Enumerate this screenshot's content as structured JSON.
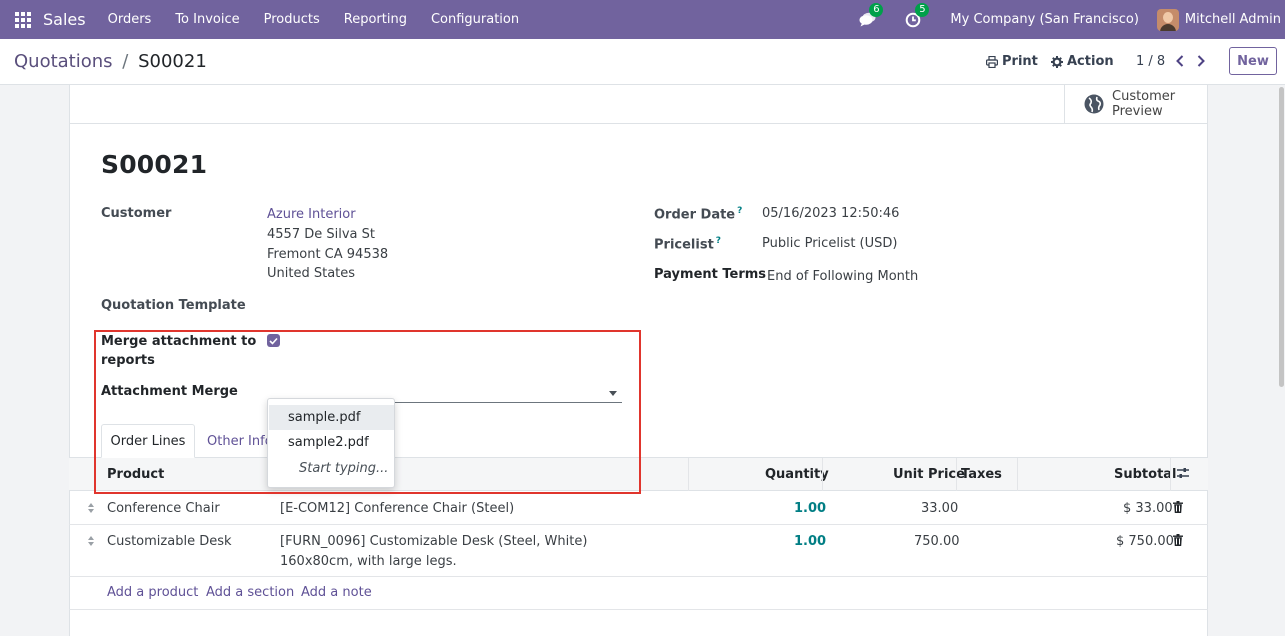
{
  "nav": {
    "brand": "Sales",
    "menu": [
      "Orders",
      "To Invoice",
      "Products",
      "Reporting",
      "Configuration"
    ],
    "messages_badge": "6",
    "activities_badge": "5",
    "company": "My Company (San Francisco)",
    "user": "Mitchell Admin"
  },
  "control_panel": {
    "breadcrumb_parent": "Quotations",
    "breadcrumb_sep": "/",
    "breadcrumb_current": "S00021",
    "print_label": "Print",
    "action_label": "Action",
    "pager": "1 / 8",
    "new_label": "New"
  },
  "form": {
    "preview_label_1": "Customer",
    "preview_label_2": "Preview",
    "title": "S00021",
    "customer_label": "Customer",
    "customer_name": "Azure Interior",
    "address_line1": "4557 De Silva St",
    "address_line2": "Fremont CA 94538",
    "address_line3": "United States",
    "quotation_template_label": "Quotation Template",
    "merge_label_1": "Merge attachment to",
    "merge_label_2": "reports",
    "merge_checked": true,
    "attachment_merge_label": "Attachment Merge",
    "order_date_label": "Order Date",
    "order_date": "05/16/2023 12:50:46",
    "pricelist_label": "Pricelist",
    "pricelist": "Public Pricelist (USD)",
    "payment_terms_label": "Payment Terms",
    "payment_terms": "End of Following Month",
    "help_mark": "?"
  },
  "tabs": {
    "order_lines": "Order Lines",
    "other_info": "Other Info"
  },
  "table": {
    "headers": {
      "product": "Product",
      "quantity": "Quantity",
      "unit_price": "Unit Price",
      "taxes": "Taxes",
      "subtotal": "Subtotal"
    },
    "rows": [
      {
        "product": "Conference Chair",
        "description": "[E-COM12] Conference Chair (Steel)",
        "description2": "",
        "quantity": "1.00",
        "unit_price": "33.00",
        "taxes": "",
        "subtotal": "$ 33.00"
      },
      {
        "product": "Customizable Desk",
        "description": "[FURN_0096] Customizable Desk (Steel, White)",
        "description2": "160x80cm, with large legs.",
        "quantity": "1.00",
        "unit_price": "750.00",
        "taxes": "",
        "subtotal": "$ 750.00"
      }
    ],
    "add_product": "Add a product",
    "add_section": "Add a section",
    "add_note": "Add a note"
  },
  "dropdown": {
    "options": [
      "sample.pdf",
      "sample2.pdf"
    ],
    "hint": "Start typing..."
  },
  "colors": {
    "brand": "#71639e",
    "badge": "#00a04a",
    "highlight": "#e0352d",
    "quantity": "#017e84"
  },
  "icons": [
    "apps-icon",
    "chat-icon",
    "clock-icon",
    "print-icon",
    "gear-icon",
    "chevron-left-icon",
    "chevron-right-icon",
    "globe-icon",
    "checkbox-check-icon",
    "caret-down-icon",
    "sliders-icon",
    "drag-handle-icon",
    "trash-icon"
  ]
}
